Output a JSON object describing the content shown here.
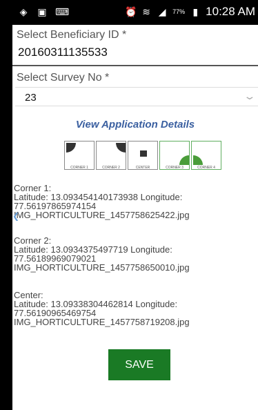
{
  "status_bar": {
    "left_icons": [
      "location-icon",
      "image-icon",
      "keyboard-icon"
    ],
    "right_icons": [
      "alarm-icon",
      "wifi-icon",
      "signal-icon",
      "battery-icon"
    ],
    "battery": "77%",
    "time": "10:28 AM"
  },
  "form": {
    "beneficiary_label": "Select Beneficiary ID *",
    "beneficiary_value": "20160311135533",
    "survey_label": "Select Survey No *",
    "survey_value": "23"
  },
  "view_link": "View Application Details",
  "corner_captions": [
    "CORNER 1",
    "CORNER 2",
    "CENTER",
    "CORNER 3",
    "CORNER 4"
  ],
  "corner_states": [
    "captured",
    "captured",
    "captured",
    "captured",
    "captured"
  ],
  "locations": {
    "corner1": {
      "title": "Corner 1:",
      "lat_line": "Latitude: 13.093454140173938  Longitude:",
      "lon_line": "77.56197865974154",
      "file": "IMG_HORTICULTURE_1457758625422.jpg"
    },
    "corner2": {
      "title": "Corner 2:",
      "lat_line": "Latitude: 13.0934375497719  Longitude:",
      "lon_line": "77.56189969079021",
      "file": "IMG_HORTICULTURE_1457758650010.jpg"
    },
    "center": {
      "title": "Center:",
      "lat_line": "Latitude: 13.09338304462814  Longitude:",
      "lon_line": "77.56190965469754",
      "file": "IMG_HORTICULTURE_1457758719208.jpg"
    }
  },
  "save_label": "SAVE",
  "colors": {
    "save": "#1a7a25",
    "link": "#3a5fa0",
    "green_marker": "#4a9d3a"
  }
}
